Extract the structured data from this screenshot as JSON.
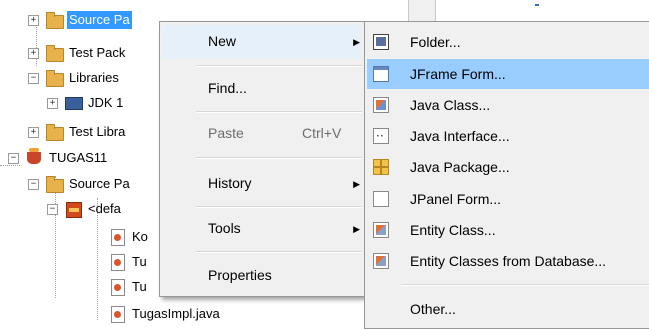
{
  "tree": {
    "items": [
      {
        "label": "Source Pa"
      },
      {
        "label": "Test Pack"
      },
      {
        "label": "Libraries"
      },
      {
        "label": "JDK 1"
      },
      {
        "label": "Test Libra"
      },
      {
        "label": "TUGAS11"
      },
      {
        "label": "Source Pa"
      },
      {
        "label": "<defa"
      },
      {
        "label": "Ko"
      },
      {
        "label": "Tu"
      },
      {
        "label": "Tu"
      },
      {
        "label": "TugasImpl.java"
      }
    ]
  },
  "context_menu": {
    "items": [
      {
        "label": "New",
        "has_submenu": true,
        "highlighted": true
      },
      {
        "label": "Find..."
      },
      {
        "label": "Paste",
        "shortcut": "Ctrl+V",
        "disabled": true
      },
      {
        "label": "History",
        "has_submenu": true
      },
      {
        "label": "Tools",
        "has_submenu": true
      },
      {
        "label": "Properties"
      }
    ]
  },
  "submenu": {
    "items": [
      {
        "label": "Folder...",
        "icon": "folder-icon"
      },
      {
        "label": "JFrame Form...",
        "icon": "jframe-form-icon",
        "highlighted": true
      },
      {
        "label": "Java Class...",
        "icon": "java-class-icon"
      },
      {
        "label": "Java Interface...",
        "icon": "java-interface-icon"
      },
      {
        "label": "Java Package...",
        "icon": "java-package-icon"
      },
      {
        "label": "JPanel Form...",
        "icon": "jpanel-form-icon"
      },
      {
        "label": "Entity Class...",
        "icon": "entity-class-icon"
      },
      {
        "label": "Entity Classes from Database...",
        "icon": "entity-classes-db-icon"
      },
      {
        "label": "Other..."
      }
    ]
  },
  "colors": {
    "selection": "#3399ff",
    "submenu_highlight": "#99ccff",
    "menu_background": "#f0f0f0"
  }
}
